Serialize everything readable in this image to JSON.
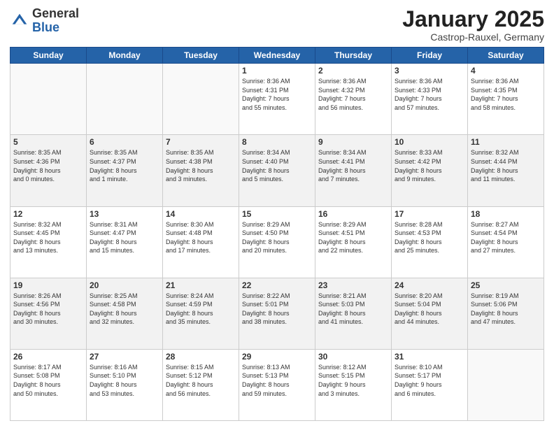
{
  "header": {
    "logo_line1": "General",
    "logo_line2": "Blue",
    "month_year": "January 2025",
    "location": "Castrop-Rauxel, Germany"
  },
  "days_of_week": [
    "Sunday",
    "Monday",
    "Tuesday",
    "Wednesday",
    "Thursday",
    "Friday",
    "Saturday"
  ],
  "weeks": [
    [
      {
        "day": "",
        "info": ""
      },
      {
        "day": "",
        "info": ""
      },
      {
        "day": "",
        "info": ""
      },
      {
        "day": "1",
        "info": "Sunrise: 8:36 AM\nSunset: 4:31 PM\nDaylight: 7 hours\nand 55 minutes."
      },
      {
        "day": "2",
        "info": "Sunrise: 8:36 AM\nSunset: 4:32 PM\nDaylight: 7 hours\nand 56 minutes."
      },
      {
        "day": "3",
        "info": "Sunrise: 8:36 AM\nSunset: 4:33 PM\nDaylight: 7 hours\nand 57 minutes."
      },
      {
        "day": "4",
        "info": "Sunrise: 8:36 AM\nSunset: 4:35 PM\nDaylight: 7 hours\nand 58 minutes."
      }
    ],
    [
      {
        "day": "5",
        "info": "Sunrise: 8:35 AM\nSunset: 4:36 PM\nDaylight: 8 hours\nand 0 minutes."
      },
      {
        "day": "6",
        "info": "Sunrise: 8:35 AM\nSunset: 4:37 PM\nDaylight: 8 hours\nand 1 minute."
      },
      {
        "day": "7",
        "info": "Sunrise: 8:35 AM\nSunset: 4:38 PM\nDaylight: 8 hours\nand 3 minutes."
      },
      {
        "day": "8",
        "info": "Sunrise: 8:34 AM\nSunset: 4:40 PM\nDaylight: 8 hours\nand 5 minutes."
      },
      {
        "day": "9",
        "info": "Sunrise: 8:34 AM\nSunset: 4:41 PM\nDaylight: 8 hours\nand 7 minutes."
      },
      {
        "day": "10",
        "info": "Sunrise: 8:33 AM\nSunset: 4:42 PM\nDaylight: 8 hours\nand 9 minutes."
      },
      {
        "day": "11",
        "info": "Sunrise: 8:32 AM\nSunset: 4:44 PM\nDaylight: 8 hours\nand 11 minutes."
      }
    ],
    [
      {
        "day": "12",
        "info": "Sunrise: 8:32 AM\nSunset: 4:45 PM\nDaylight: 8 hours\nand 13 minutes."
      },
      {
        "day": "13",
        "info": "Sunrise: 8:31 AM\nSunset: 4:47 PM\nDaylight: 8 hours\nand 15 minutes."
      },
      {
        "day": "14",
        "info": "Sunrise: 8:30 AM\nSunset: 4:48 PM\nDaylight: 8 hours\nand 17 minutes."
      },
      {
        "day": "15",
        "info": "Sunrise: 8:29 AM\nSunset: 4:50 PM\nDaylight: 8 hours\nand 20 minutes."
      },
      {
        "day": "16",
        "info": "Sunrise: 8:29 AM\nSunset: 4:51 PM\nDaylight: 8 hours\nand 22 minutes."
      },
      {
        "day": "17",
        "info": "Sunrise: 8:28 AM\nSunset: 4:53 PM\nDaylight: 8 hours\nand 25 minutes."
      },
      {
        "day": "18",
        "info": "Sunrise: 8:27 AM\nSunset: 4:54 PM\nDaylight: 8 hours\nand 27 minutes."
      }
    ],
    [
      {
        "day": "19",
        "info": "Sunrise: 8:26 AM\nSunset: 4:56 PM\nDaylight: 8 hours\nand 30 minutes."
      },
      {
        "day": "20",
        "info": "Sunrise: 8:25 AM\nSunset: 4:58 PM\nDaylight: 8 hours\nand 32 minutes."
      },
      {
        "day": "21",
        "info": "Sunrise: 8:24 AM\nSunset: 4:59 PM\nDaylight: 8 hours\nand 35 minutes."
      },
      {
        "day": "22",
        "info": "Sunrise: 8:22 AM\nSunset: 5:01 PM\nDaylight: 8 hours\nand 38 minutes."
      },
      {
        "day": "23",
        "info": "Sunrise: 8:21 AM\nSunset: 5:03 PM\nDaylight: 8 hours\nand 41 minutes."
      },
      {
        "day": "24",
        "info": "Sunrise: 8:20 AM\nSunset: 5:04 PM\nDaylight: 8 hours\nand 44 minutes."
      },
      {
        "day": "25",
        "info": "Sunrise: 8:19 AM\nSunset: 5:06 PM\nDaylight: 8 hours\nand 47 minutes."
      }
    ],
    [
      {
        "day": "26",
        "info": "Sunrise: 8:17 AM\nSunset: 5:08 PM\nDaylight: 8 hours\nand 50 minutes."
      },
      {
        "day": "27",
        "info": "Sunrise: 8:16 AM\nSunset: 5:10 PM\nDaylight: 8 hours\nand 53 minutes."
      },
      {
        "day": "28",
        "info": "Sunrise: 8:15 AM\nSunset: 5:12 PM\nDaylight: 8 hours\nand 56 minutes."
      },
      {
        "day": "29",
        "info": "Sunrise: 8:13 AM\nSunset: 5:13 PM\nDaylight: 8 hours\nand 59 minutes."
      },
      {
        "day": "30",
        "info": "Sunrise: 8:12 AM\nSunset: 5:15 PM\nDaylight: 9 hours\nand 3 minutes."
      },
      {
        "day": "31",
        "info": "Sunrise: 8:10 AM\nSunset: 5:17 PM\nDaylight: 9 hours\nand 6 minutes."
      },
      {
        "day": "",
        "info": ""
      }
    ]
  ]
}
